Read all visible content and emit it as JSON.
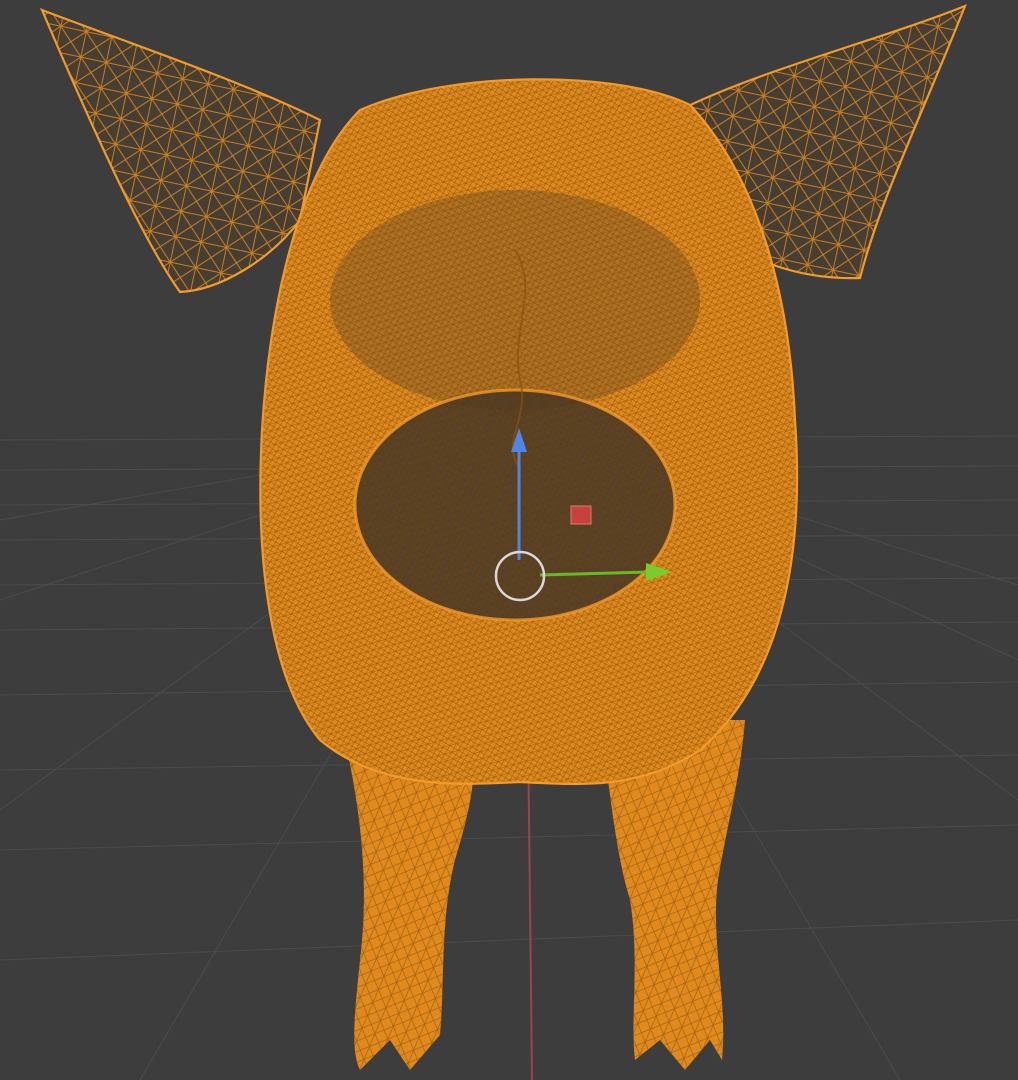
{
  "viewport": {
    "mode": "wireframe",
    "object": "pig-mesh",
    "selected": true,
    "colors": {
      "background": "#3d3d3d",
      "grid": "#4c4c4c",
      "x_axis": "#a0424c",
      "selection": "#e08a1e",
      "gizmo_z": "#4d86e8",
      "gizmo_y": "#68b82a",
      "pivot": "#d8d8d8",
      "light_marker": "#c5423f"
    },
    "icons": [
      "pivot-ring-icon",
      "transform-gizmo-icon",
      "light-marker-icon"
    ]
  }
}
